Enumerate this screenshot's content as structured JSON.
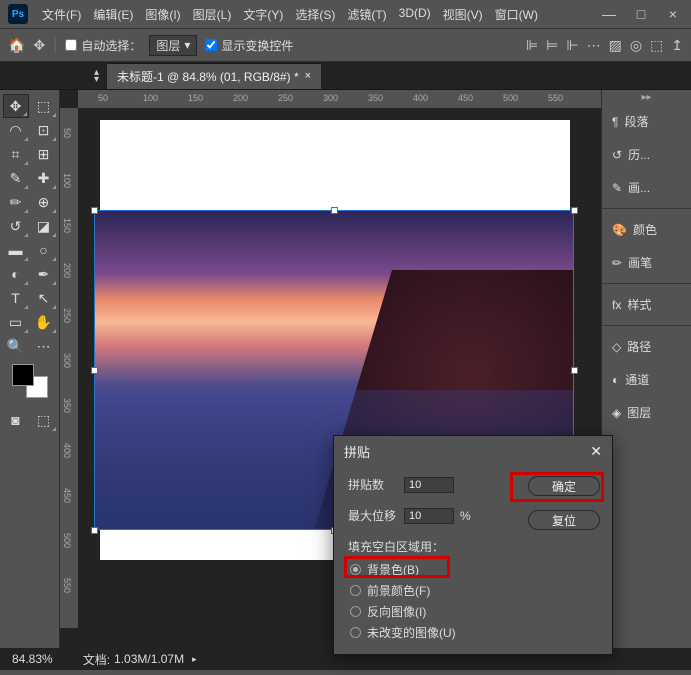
{
  "app": {
    "logo_text": "Ps"
  },
  "menu": [
    "文件(F)",
    "编辑(E)",
    "图像(I)",
    "图层(L)",
    "文字(Y)",
    "选择(S)",
    "滤镜(T)",
    "3D(D)",
    "视图(V)",
    "窗口(W)"
  ],
  "window_controls": [
    "—",
    "□",
    "×"
  ],
  "options": {
    "auto_select_label": "自动选择：",
    "layer_dropdown": "图层",
    "show_transform_label": "显示变换控件"
  },
  "document": {
    "tab_title": "未标题-1 @ 84.8% (01, RGB/8#) *"
  },
  "ruler_h": [
    "50",
    "100",
    "150",
    "200",
    "250",
    "300",
    "350",
    "400",
    "450",
    "500",
    "550"
  ],
  "ruler_v": [
    "50",
    "100",
    "150",
    "200",
    "250",
    "300",
    "350",
    "400",
    "450",
    "500",
    "550"
  ],
  "panels": [
    {
      "icon": "¶",
      "label": "段落"
    },
    {
      "icon": "↺",
      "label": "历..."
    },
    {
      "icon": "✎",
      "label": "画..."
    },
    {
      "icon": "🎨",
      "label": "颜色"
    },
    {
      "icon": "✏",
      "label": "画笔"
    },
    {
      "icon": "fx",
      "label": "样式"
    },
    {
      "icon": "◇",
      "label": "路径"
    },
    {
      "icon": "◐",
      "label": "通道"
    },
    {
      "icon": "◈",
      "label": "图层"
    }
  ],
  "status": {
    "zoom": "84.83%",
    "doc_size_label": "文档:",
    "doc_size_value": "1.03M/1.07M"
  },
  "dialog": {
    "title": "拼贴",
    "count_label": "拼贴数",
    "count_value": "10",
    "offset_label": "最大位移",
    "offset_value": "10",
    "offset_unit": "%",
    "fill_label": "填充空白区域用：",
    "radios": [
      {
        "label": "背景色(B)",
        "selected": true
      },
      {
        "label": "前景颜色(F)",
        "selected": false
      },
      {
        "label": "反向图像(I)",
        "selected": false
      },
      {
        "label": "未改变的图像(U)",
        "selected": false
      }
    ],
    "ok_btn": "确定",
    "reset_btn": "复位"
  }
}
